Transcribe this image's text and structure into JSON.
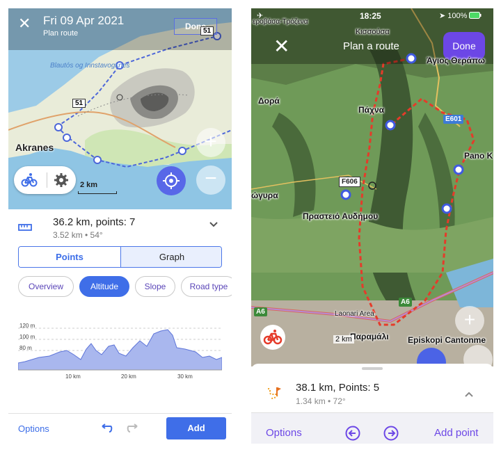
{
  "android": {
    "header": {
      "title": "Fri 09 Apr 2021",
      "subtitle": "Plan route",
      "done_label": "Done"
    },
    "map": {
      "place_label": "Akranes",
      "lake_label": "Blautós og Innstavogsnes",
      "road_sign_1": "51",
      "road_sign_2": "51",
      "scale_label": "2 km"
    },
    "summary": {
      "distance": "36.2 km, points: 7",
      "meta": "3.52 km • 54°"
    },
    "tabs": {
      "points": "Points",
      "graph": "Graph"
    },
    "chips": {
      "overview": "Overview",
      "altitude": "Altitude",
      "slope": "Slope",
      "road_type": "Road type"
    },
    "bottom": {
      "options": "Options",
      "add": "Add"
    },
    "colors": {
      "accent": "#3f6ee8",
      "chip_text": "#5a45b8"
    }
  },
  "ios": {
    "status": {
      "left": "✈",
      "time": "18:25",
      "battery": "100%"
    },
    "header": {
      "title": "Plan a route",
      "done_label": "Done"
    },
    "map": {
      "labels": {
        "l1": "εροβάσα-Τρόζενα",
        "l2": "Κισσούσα",
        "l3": "Άγιος Θεράπω",
        "l4": "Δορά",
        "l5": "Πάχνα",
        "l6": "Pano K",
        "l7": "ώγυρα",
        "l8": "Πραστειό Αυδήμου",
        "l9": "Laonari Area",
        "l10": "Παραμάλι",
        "l11": "Episkopi Cantonme"
      },
      "signs": {
        "e601": "E601",
        "f606": "F606",
        "a6_left": "A6",
        "a6_right": "A6"
      },
      "scale_label": "2 km"
    },
    "summary": {
      "distance": "38.1 km, Points: 5",
      "meta": "1.34 km • 72°"
    },
    "bottom": {
      "options": "Options",
      "add_point": "Add point"
    },
    "colors": {
      "accent": "#6c47e6"
    }
  }
}
